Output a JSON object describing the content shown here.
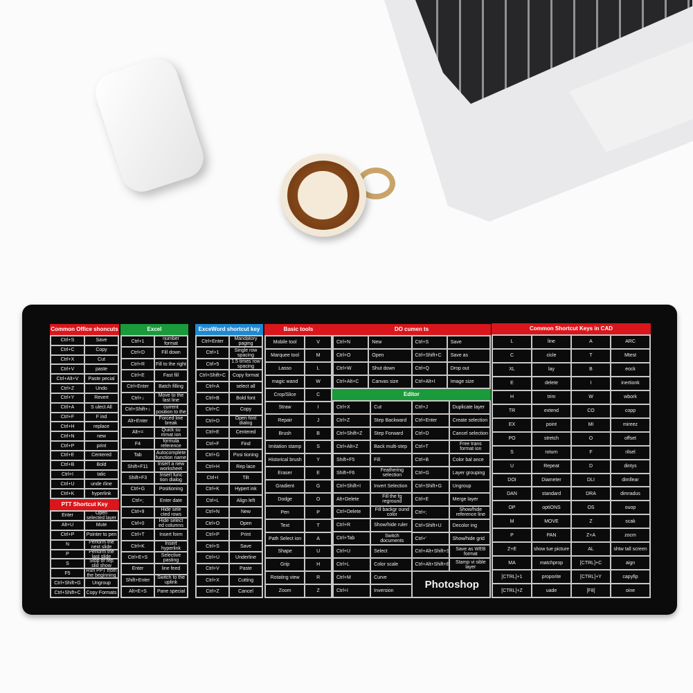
{
  "colors": {
    "red": "#d9161c",
    "green": "#1a9a3a",
    "blue": "#1e88d0",
    "mat": "#0b0b0b"
  },
  "office": {
    "title": "Common Office shoncuts",
    "rows": [
      [
        "Ctrl+S",
        "Save"
      ],
      [
        "Ctrl+C",
        "Copy"
      ],
      [
        "Ctrl+X",
        "Cut"
      ],
      [
        "Ctrl+V",
        "paste"
      ],
      [
        "Ctrl+Alt+V",
        "Paste pecial"
      ],
      [
        "Ctrl+Z",
        "Undo"
      ],
      [
        "Ctrl+Y",
        "Revert"
      ],
      [
        "Ctrl+A",
        "S ulect All"
      ],
      [
        "Ctrl+F",
        "F ind"
      ],
      [
        "Ctrl+H",
        "replace"
      ],
      [
        "Ctrl+N",
        "new"
      ],
      [
        "Ctrl+P",
        "print"
      ],
      [
        "Ctrl+E",
        "Centered"
      ],
      [
        "Ctrl+B",
        "Bold"
      ],
      [
        "Ctrl+I",
        "talic"
      ],
      [
        "Ctrl+U",
        "unde rline"
      ],
      [
        "Ctrl+K",
        "hyperlink"
      ]
    ]
  },
  "ptt": {
    "title": "PTT Shortcut Key",
    "rows": [
      [
        "Enter",
        "Open selected layer"
      ],
      [
        "Alt+U",
        "Mute"
      ],
      [
        "Ctrl+P",
        "Pointer to pen"
      ],
      [
        "N",
        "Perform the next slide"
      ],
      [
        "P",
        "Perform the last slide"
      ],
      [
        "S",
        "Stop or rep slid show"
      ],
      [
        "F5",
        "Run PPT from the beginning"
      ],
      [
        "Ctrl+Shift+G",
        "Ungroup"
      ],
      [
        "Ctrl+Shift+C",
        "Copy Formats"
      ]
    ]
  },
  "excel": {
    "title": "Excel",
    "rows": [
      [
        "Ctrl+1",
        "Open the number format window"
      ],
      [
        "Ctrl+D",
        "Fill down"
      ],
      [
        "Ctrl+R",
        "Fill to the right"
      ],
      [
        "Ctrl+E",
        "Fast fill"
      ],
      [
        "Ctrl+Enter",
        "Batch filling"
      ],
      [
        "Ctrl+↓",
        "Move to the last line"
      ],
      [
        "Ctrl+Shift+↓",
        "Check the current position to the last line"
      ],
      [
        "Alt+Enter",
        "Forced line break"
      ],
      [
        "Alt+=",
        "Quick su mmat ion"
      ],
      [
        "F4",
        "Switch formula reference format"
      ],
      [
        "Tab",
        "Autocomplete function name"
      ],
      [
        "Shift+F11",
        "Insert a new worksheet"
      ],
      [
        "Shift+F3",
        "Insert func tion dialog"
      ],
      [
        "Ctrl+G",
        "Positioning"
      ],
      [
        "Ctrl+;",
        "Enter date"
      ],
      [
        "Ctrl+9",
        "Hide sele cted rows"
      ],
      [
        "Ctrl+0",
        "Hide select ed columns"
      ],
      [
        "Ctrl+T",
        "Insert form"
      ],
      [
        "Ctrl+K",
        "Insert hyperlink"
      ],
      [
        "Ctrl+E+S",
        "Selective pasting"
      ],
      [
        "Enter",
        "line feed"
      ],
      [
        "Shift+Enter",
        "Switch to the uplink"
      ],
      [
        "Alt+E+S",
        "Pane special"
      ]
    ]
  },
  "word": {
    "title": "ExceWord shortcut key",
    "rows": [
      [
        "Ctrl+Enter",
        "Mandatory paging"
      ],
      [
        "Ctrl+1",
        "Single row spacing"
      ],
      [
        "Ctrl+5",
        "1.5 times row spacing"
      ],
      [
        "Ctrl+Shift+C",
        "Copy format"
      ],
      [
        "Ctrl+A",
        "select all"
      ],
      [
        "Ctrl+B",
        "Bold font"
      ],
      [
        "Ctrl+C",
        "Copy"
      ],
      [
        "Ctrl+D",
        "Open font dialog"
      ],
      [
        "Ctrl+E",
        "Centered"
      ],
      [
        "Ctrl+F",
        "Find"
      ],
      [
        "Ctrl+G",
        "Posi tioning"
      ],
      [
        "Ctrl+H",
        "Rep lace"
      ],
      [
        "Ctrl+I",
        "Tilt"
      ],
      [
        "Ctrl+K",
        "Hypert ink"
      ],
      [
        "Ctrl+L",
        "Align left"
      ],
      [
        "Ctrl+N",
        "New"
      ],
      [
        "Ctrl+O",
        "Open"
      ],
      [
        "Ctrl+P",
        "Print"
      ],
      [
        "Ctrl+S",
        "Save"
      ],
      [
        "Ctrl+U",
        "Underline"
      ],
      [
        "Ctrl+V",
        "Paste"
      ],
      [
        "Ctrl+X",
        "Cutting"
      ],
      [
        "Ctrl+Z",
        "Cancel"
      ]
    ]
  },
  "basic": {
    "title": "Basic tools",
    "rows": [
      [
        "Mobile tool",
        "V"
      ],
      [
        "Marquee tool",
        "M"
      ],
      [
        "Lasso",
        "L"
      ],
      [
        "magic wand",
        "W"
      ],
      [
        "Crop/Slice",
        "C"
      ],
      [
        "Straw",
        "I"
      ],
      [
        "Repair",
        "J"
      ],
      [
        "Brush",
        "B"
      ],
      [
        "Imitation stamp",
        "S"
      ],
      [
        "Historical brush",
        "Y"
      ],
      [
        "Eraser",
        "E"
      ],
      [
        "Gradient",
        "G"
      ],
      [
        "Dodge",
        "O"
      ],
      [
        "Pen",
        "P"
      ],
      [
        "Text",
        "T"
      ],
      [
        "Path Select ion",
        "A"
      ],
      [
        "Shape",
        "U"
      ],
      [
        "Grip",
        "H"
      ],
      [
        "Rotating view",
        "R"
      ],
      [
        "Zoom",
        "Z"
      ]
    ]
  },
  "documents": {
    "title": "DO cumen ts",
    "rows": [
      [
        "Ctrl+N",
        "New",
        "Ctrl+S",
        "Save"
      ],
      [
        "Ctrl+O",
        "Open",
        "Ctrl+Shift+C",
        "Save as"
      ],
      [
        "Ctrl+W",
        "Shut down",
        "Ctrl+Q",
        "Drop out"
      ],
      [
        "Ctrl+Alt+C",
        "Canvas size",
        "Ctrl+Alt+I",
        "Image size"
      ]
    ]
  },
  "editor": {
    "title": "Editor",
    "left": [
      [
        "Ctrl+X",
        "Cut"
      ],
      [
        "Ctrl+Z",
        "Step Backward"
      ],
      [
        "Ctrl+Shift+Z",
        "Step Forward"
      ],
      [
        "Ctrl+Alt+Z",
        "Back multi-step"
      ],
      [
        "Shift+F5",
        "Fill"
      ],
      [
        "Shift+F6",
        "Feathering selection"
      ],
      [
        "Ctrl+Shift+I",
        "Invert Selection"
      ],
      [
        "Alt+Delete",
        "Fill the fg reground"
      ],
      [
        "Ctrl+Delete",
        "Fill backgr ound color"
      ],
      [
        "Ctrl+R",
        "Show/hide ruler"
      ],
      [
        "Ctrl+Tab",
        "Switch documents"
      ],
      [
        "Ctrl+U",
        "Select"
      ],
      [
        "Ctrl+L",
        "Color scale"
      ],
      [
        "Ctrl+M",
        "Curve"
      ],
      [
        "Ctrl+I",
        "Inversion"
      ]
    ],
    "right": [
      [
        "Ctrl+J",
        "Duplicate layer"
      ],
      [
        "Ctrl+Enter",
        "Create selection"
      ],
      [
        "Ctrl+D",
        "Cancel selection"
      ],
      [
        "Ctrl+T",
        "Free trans format ion"
      ],
      [
        "Ctrl+B",
        "Color bal ance"
      ],
      [
        "Ctrl+G",
        "Layer grouping"
      ],
      [
        "Ctrl+Shift+G",
        "Ungroup"
      ],
      [
        "Ctrl+E",
        "Merge layer"
      ],
      [
        "Ctrl+;",
        "Show/hide reference line"
      ],
      [
        "Ctrl+Shift+U",
        "Decolor ing"
      ],
      [
        "Ctrl+'",
        "Show/hide grid"
      ],
      [
        "Ctrl+Alt+Shift+S",
        "Save as WEB format"
      ],
      [
        "Ctrl+Alt+Shift+E",
        "Stamp vi sible layer"
      ]
    ],
    "brand": "Photoshop"
  },
  "cad": {
    "title": "Common Shortcut Keys in CAD",
    "rows": [
      [
        "L",
        "line",
        "A",
        "ARC"
      ],
      [
        "C",
        "cicle",
        "T",
        "Mtest"
      ],
      [
        "XL",
        "lay",
        "B",
        "eock"
      ],
      [
        "E",
        "delete",
        "I",
        "inertionk"
      ],
      [
        "H",
        "trim",
        "W",
        "wbork"
      ],
      [
        "TR",
        "extend",
        "CO",
        "copp"
      ],
      [
        "EX",
        "point",
        "MI",
        "mireez"
      ],
      [
        "PO",
        "stretch",
        "O",
        "offset"
      ],
      [
        "S",
        "roturn",
        "F",
        "rilsel"
      ],
      [
        "U",
        "Repeat",
        "D",
        "dintys"
      ],
      [
        "DOI",
        "Diameter",
        "DLI",
        "dimllear"
      ],
      [
        "DAN",
        "standard",
        "DRA",
        "dimradus"
      ],
      [
        "OP",
        "optiONS",
        "OS",
        "ouop"
      ],
      [
        "M",
        "MOVE",
        "Z",
        "scak"
      ],
      [
        "P",
        "PAN",
        "Z+A",
        "zocm"
      ],
      [
        "Z+E",
        "show tue picture",
        "AL",
        "shtw tall screen"
      ],
      [
        "MA",
        "matchprop",
        "[CTRL]+C",
        "aign"
      ],
      [
        "[CTRL]+1",
        "proporite",
        "[CTRL]+Y",
        "capyfip"
      ],
      [
        "[CTRL]+Z",
        "uade",
        "[F8]",
        "oine"
      ]
    ]
  }
}
